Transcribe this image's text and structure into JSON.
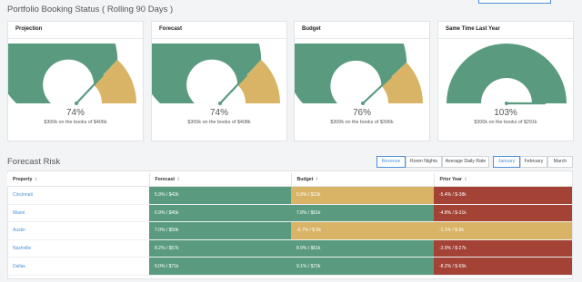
{
  "portfolio": {
    "title": "Portfolio Booking Status ( Rolling 90 Days )",
    "cards": [
      {
        "title": "Projection",
        "percent": "74%",
        "caption": "$300k on the books of $406k",
        "value": 74
      },
      {
        "title": "Forecast",
        "percent": "74%",
        "caption": "$300k on the books of $408k",
        "value": 74
      },
      {
        "title": "Budget",
        "percent": "76%",
        "caption": "$300k on the books of $396k",
        "value": 76
      },
      {
        "title": "Same Time Last Year",
        "percent": "103%",
        "caption": "$300k on the books of $291k",
        "value": 103
      }
    ]
  },
  "risk": {
    "title": "Forecast Risk",
    "metric_buttons": [
      "Revenue",
      "Room Nights",
      "Average Daily Rate"
    ],
    "month_buttons": [
      "January",
      "February",
      "March"
    ],
    "active_metric": "Revenue",
    "active_month": "January",
    "columns": [
      "Property",
      "Forecast",
      "Budget",
      "Prior Year"
    ],
    "rows": [
      {
        "property": "Cincinnati",
        "forecast": "5.9% / $42k",
        "budget": "5.9% / $12k",
        "prior": "-5.4% / $-38k"
      },
      {
        "property": "Miami",
        "forecast": "6.9% / $45k",
        "budget": "7.8% / $51k",
        "prior": "-4.8% / $-31k"
      },
      {
        "property": "Austin",
        "forecast": "7.0% / $50k",
        "budget": "-0.7% / $-5k",
        "prior": "-1.1% / $-8k"
      },
      {
        "property": "Nashville",
        "forecast": "8.2% / $57k",
        "budget": "8.9% / $61k",
        "prior": "-3.9% / $-27k"
      },
      {
        "property": "Dallas",
        "forecast": "9.0% / $71k",
        "budget": "9.1% / $72k",
        "prior": "-8.2% / $-65k"
      }
    ],
    "cell_colors": [
      [
        "green",
        "yellow",
        "red"
      ],
      [
        "green",
        "green",
        "red"
      ],
      [
        "green",
        "yellow",
        "yellow"
      ],
      [
        "green",
        "green",
        "red"
      ],
      [
        "green",
        "green",
        "red"
      ]
    ]
  },
  "colors": {
    "green": "#5a9b7f",
    "yellow": "#d9b466",
    "red": "#a34235",
    "accent": "#4a90d9"
  }
}
